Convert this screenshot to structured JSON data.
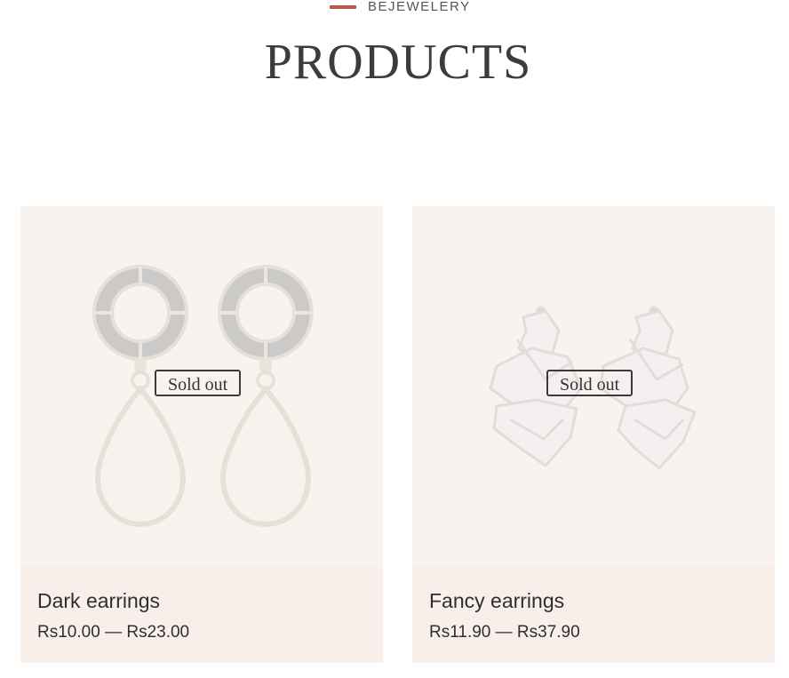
{
  "header": {
    "eyebrow": "BEJEWELERY",
    "title": "PRODUCTS"
  },
  "colors": {
    "accent": "#b85a48",
    "card_background": "#f9f2ee",
    "text": "#2f2f2f"
  },
  "products": [
    {
      "name": "Dark earrings",
      "price_from": "Rs10.00",
      "separator": "—",
      "price_to": "Rs23.00",
      "badge": "Sold out",
      "image": "drop-earrings-image"
    },
    {
      "name": "Fancy earrings",
      "price_from": "Rs11.90",
      "separator": "—",
      "price_to": "Rs37.90",
      "badge": "Sold out",
      "image": "crumpled-silver-earrings-image"
    }
  ]
}
